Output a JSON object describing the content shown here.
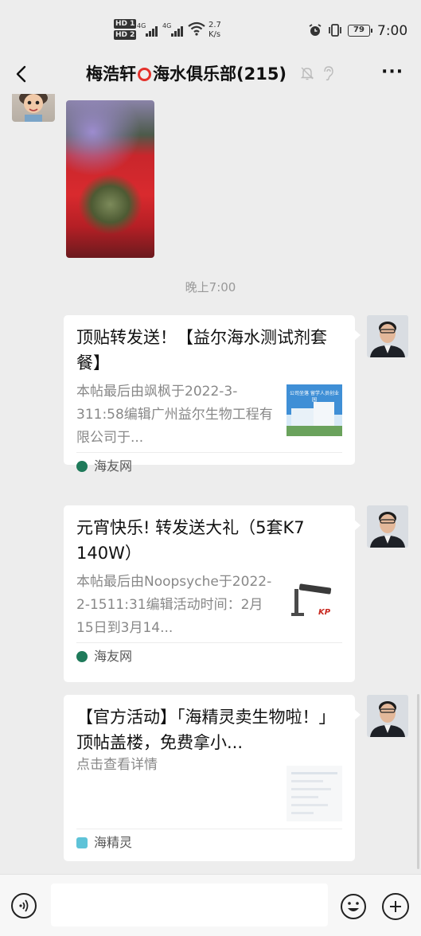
{
  "status_bar": {
    "hd1": "HD 1",
    "hd2": "HD 2",
    "sig1": "4G",
    "sig2": "4G",
    "speed_value": "2.7",
    "speed_unit": "K/s",
    "battery": "79",
    "time": "7:00"
  },
  "header": {
    "title_part1": "梅浩轩",
    "title_part2": "海水俱乐部(215)",
    "more": "···"
  },
  "chat": {
    "time_label": "晚上7:00",
    "cards": [
      {
        "title": "顶贴转发送！【益尔海水测试剂套餐】",
        "desc": "本帖最后由飒枫于2022-3-311:58编辑广州益尔生物工程有限公司于...",
        "source": "海友网",
        "thumb_text": "公司坐落 留学人员创业园"
      },
      {
        "title": "元宵快乐! 转发送大礼（5套K7 140W）",
        "desc": "本帖最后由Noopsyche于2022-2-1511:31编辑活动时间：2月15日到3月14...",
        "source": "海友网",
        "thumb_text": "KP"
      },
      {
        "title": "【官方活动】「海精灵卖生物啦！」顶帖盖楼，免费拿小...",
        "desc": "点击查看详情",
        "source": "海精灵"
      }
    ]
  },
  "colors": {
    "accent_red": "#e4312b",
    "background": "#ededed",
    "source_green": "#1f7a5a"
  }
}
